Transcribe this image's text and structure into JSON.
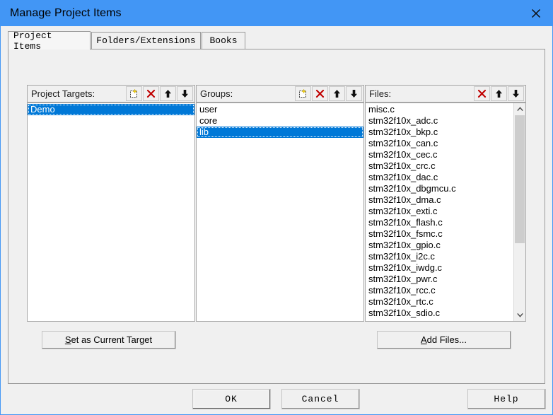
{
  "window": {
    "title": "Manage Project Items",
    "close_icon": "close-icon",
    "titlebar_color": "#4296F5"
  },
  "tabs": [
    {
      "label": "Project Items",
      "active": true
    },
    {
      "label": "Folders/Extensions",
      "active": false
    },
    {
      "label": "Books",
      "active": false
    }
  ],
  "panels": {
    "project_targets": {
      "label": "Project Targets:",
      "tools": [
        {
          "name": "new-item-icon",
          "title": "New (Insert)"
        },
        {
          "name": "delete-icon",
          "title": "Remove"
        },
        {
          "name": "move-up-icon",
          "title": "Move Up"
        },
        {
          "name": "move-down-icon",
          "title": "Move Down"
        }
      ],
      "items": [
        {
          "label": "Demo",
          "selected": true
        }
      ]
    },
    "groups": {
      "label": "Groups:",
      "tools": [
        {
          "name": "new-item-icon",
          "title": "New (Insert)"
        },
        {
          "name": "delete-icon",
          "title": "Remove"
        },
        {
          "name": "move-up-icon",
          "title": "Move Up"
        },
        {
          "name": "move-down-icon",
          "title": "Move Down"
        }
      ],
      "items": [
        {
          "label": "user",
          "selected": false
        },
        {
          "label": "core",
          "selected": false
        },
        {
          "label": "lib",
          "selected": true
        }
      ]
    },
    "files": {
      "label": "Files:",
      "tools": [
        {
          "name": "delete-icon",
          "title": "Remove"
        },
        {
          "name": "move-up-icon",
          "title": "Move Up"
        },
        {
          "name": "move-down-icon",
          "title": "Move Down"
        }
      ],
      "items": [
        {
          "label": "misc.c",
          "selected": false
        },
        {
          "label": "stm32f10x_adc.c",
          "selected": false
        },
        {
          "label": "stm32f10x_bkp.c",
          "selected": false
        },
        {
          "label": "stm32f10x_can.c",
          "selected": false
        },
        {
          "label": "stm32f10x_cec.c",
          "selected": false
        },
        {
          "label": "stm32f10x_crc.c",
          "selected": false
        },
        {
          "label": "stm32f10x_dac.c",
          "selected": false
        },
        {
          "label": "stm32f10x_dbgmcu.c",
          "selected": false
        },
        {
          "label": "stm32f10x_dma.c",
          "selected": false
        },
        {
          "label": "stm32f10x_exti.c",
          "selected": false
        },
        {
          "label": "stm32f10x_flash.c",
          "selected": false
        },
        {
          "label": "stm32f10x_fsmc.c",
          "selected": false
        },
        {
          "label": "stm32f10x_gpio.c",
          "selected": false
        },
        {
          "label": "stm32f10x_i2c.c",
          "selected": false
        },
        {
          "label": "stm32f10x_iwdg.c",
          "selected": false
        },
        {
          "label": "stm32f10x_pwr.c",
          "selected": false
        },
        {
          "label": "stm32f10x_rcc.c",
          "selected": false
        },
        {
          "label": "stm32f10x_rtc.c",
          "selected": false
        },
        {
          "label": "stm32f10x_sdio.c",
          "selected": false
        }
      ],
      "scrollbar": {
        "up_arrow": "scroll-up-icon",
        "down_arrow": "scroll-down-icon",
        "thumb_top_pct": 0,
        "thumb_height_pct": 66
      }
    }
  },
  "buttons": {
    "set_current_target": {
      "accel": "S",
      "rest": "et as Current Target"
    },
    "add_files": {
      "accel": "A",
      "rest": "dd Files..."
    },
    "ok": "OK",
    "cancel": "Cancel",
    "help": "Help"
  },
  "colors": {
    "selection": "#0078D7",
    "title_blue": "#4296F5",
    "dialog_face": "#F0F0F0",
    "delete_red": "#C00000"
  }
}
